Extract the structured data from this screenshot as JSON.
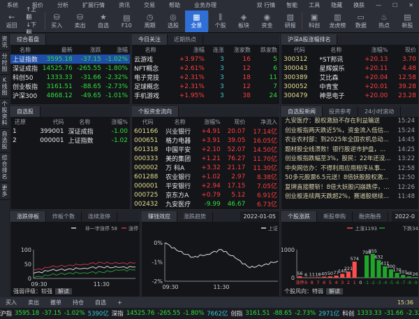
{
  "menu": [
    "系统",
    "报价",
    "分析",
    "扩展行情",
    "资讯",
    "交易",
    "帮助",
    "业务办理"
  ],
  "menu_right": [
    "双 行情",
    "智能",
    "工具",
    "隐藏",
    "换肤"
  ],
  "toolbar": {
    "back": "返回",
    "up": "上翻",
    "down": "下翻",
    "buttons": [
      {
        "label": "买入",
        "icon": "moneybag-icon"
      },
      {
        "label": "卖出",
        "icon": "moneybag-icon"
      },
      {
        "label": "自选",
        "icon": "star-icon"
      },
      {
        "label": "F10",
        "icon": "document-icon"
      },
      {
        "label": "周期",
        "icon": "clock-icon"
      },
      {
        "label": "选股",
        "icon": "chart-icon"
      },
      {
        "label": "全景",
        "icon": "grid-icon",
        "active": true
      },
      {
        "label": "个股",
        "icon": "candles-icon"
      },
      {
        "label": "板块",
        "icon": "layers-icon"
      },
      {
        "label": "资金",
        "icon": "coin-icon"
      },
      {
        "label": "研报",
        "icon": "report-icon"
      },
      {
        "label": "科创",
        "icon": "kc-icon"
      },
      {
        "label": "龙虎榜",
        "icon": "bars-icon"
      },
      {
        "label": "数据",
        "icon": "monitor-icon"
      },
      {
        "label": "热点",
        "icon": "flame-icon"
      },
      {
        "label": "新股",
        "icon": "new-icon"
      }
    ]
  },
  "left_strip": [
    "资讯",
    "分时图",
    "K线图",
    "个股资料",
    "自选股",
    "综合排名",
    "更多"
  ],
  "index_panel": {
    "tab": "综合看盘",
    "headers": [
      "名称",
      "最新",
      "涨跌",
      "涨幅"
    ],
    "rows": [
      [
        "上证指数",
        "3595.18",
        "-37.15",
        "-1.02%"
      ],
      [
        "深证成指",
        "14525.76",
        "-265.55",
        "-1.80%"
      ],
      [
        "科创50",
        "1333.33",
        "-31.66",
        "-2.32%"
      ],
      [
        "创业板指",
        "3161.51",
        "-88.65",
        "-2.73%"
      ],
      [
        "沪深300",
        "4868.12",
        "-49.65",
        "-1.01%"
      ]
    ]
  },
  "hot_panel": {
    "tabs": [
      "今日关注",
      "近期热点"
    ],
    "headers": [
      "名称",
      "涨幅",
      "连涨",
      "涨家数",
      "跌家数"
    ],
    "rows": [
      [
        "云游戏",
        "+3.97%",
        "3",
        "16",
        "5"
      ],
      [
        "NFT概念",
        "+2.61%",
        "3",
        "12",
        "6"
      ],
      [
        "电子竞技",
        "+2.31%",
        "3",
        "18",
        "11"
      ],
      [
        "足球概念",
        "+2.31%",
        "3",
        "12",
        "7"
      ],
      [
        "手机游戏",
        "+1.95%",
        "3",
        "38",
        "24"
      ]
    ]
  },
  "rank_panel": {
    "tab": "沪深A股涨幅排名",
    "headers": [
      "代码",
      "名称",
      "涨幅%",
      "现价"
    ],
    "rows": [
      [
        "300312",
        "*ST邦讯",
        "+20.13",
        "3.70"
      ],
      [
        "300043",
        "星辉娱乐",
        "+20.11",
        "4.48"
      ],
      [
        "300389",
        "艾比森",
        "+20.04",
        "12.58"
      ],
      [
        "300052",
        "中青宝",
        "+20.01",
        "39.28"
      ],
      [
        "300479",
        "神思电子",
        "+20.00",
        "23.28"
      ]
    ]
  },
  "watch_panel": {
    "tab": "自选股",
    "headers": [
      "还原",
      "代码",
      "名称",
      "涨幅%"
    ],
    "rows": [
      [
        "1",
        "399001",
        "深证成指",
        "-1.00"
      ],
      [
        "2",
        "000001",
        "上证指数",
        "-1.02"
      ]
    ]
  },
  "flow_panel": {
    "tab": "个股资金流向",
    "headers": [
      "代码",
      "名称",
      "涨幅%",
      "现价",
      "净流入"
    ],
    "rows": [
      [
        "601166",
        "兴业银行",
        "+4.91",
        "20.07",
        "17.14亿"
      ],
      [
        "000651",
        "格力电器",
        "+3.91",
        "39.05",
        "16.05亿"
      ],
      [
        "601318",
        "中国平安",
        "+2.10",
        "52.07",
        "14.50亿"
      ],
      [
        "000333",
        "美的集团",
        "+1.21",
        "76.27",
        "11.70亿"
      ],
      [
        "000002",
        "万 科A",
        "+3.32",
        "21.17",
        "11.30亿"
      ],
      [
        "601288",
        "农业银行",
        "+1.02",
        "2.97",
        "8.38亿"
      ],
      [
        "000001",
        "平安银行",
        "+2.94",
        "17.15",
        "7.05亿"
      ],
      [
        "000725",
        "京东方A",
        "+0.79",
        "5.12",
        "6.91亿"
      ],
      [
        "002432",
        "九安医疗",
        "-9.99",
        "46.67",
        "6.73亿"
      ]
    ]
  },
  "news_panel": {
    "tabs": [
      "自选股新闻",
      "投资参考",
      "24小时滚动"
    ],
    "items": [
      [
        "九安医疗：股权激励不存在利益输送",
        "15:24"
      ],
      [
        "创业板指两天跌近5%，资金流入低估...",
        "15:24"
      ],
      [
        "农业农村部：到2025年全国农机总动...",
        "14:45"
      ],
      [
        "题材股全线溃败！银行股逆市护盘，...",
        "14:25"
      ],
      [
        "创业板指跌幅至3%，股民：22年还没...",
        "13:22"
      ],
      [
        "中央网信办：不得利用应用程序从事...",
        "12:58"
      ],
      [
        "50多元股票6.5元送！8倍妖股股权激...",
        "12:50"
      ],
      [
        "复牌直接腰斩！8倍大妖股闪崩跌停，...",
        "12:26"
      ],
      [
        "创业板连续两天跌超2%，赛道股继续...",
        "11:48"
      ]
    ]
  },
  "chart_data": [
    {
      "type": "line",
      "tabs": [
        "涨跌停板",
        "炸板个数",
        "连续涨停"
      ],
      "legend": [
        "非一字涨停 58",
        "涨停"
      ],
      "x": [
        "09:30",
        "10:00",
        "10:30",
        "11:00",
        "11:30",
        "13:30",
        "14:00"
      ],
      "xticks": [
        "09:30",
        "11:30"
      ],
      "yticks": [
        "0",
        "50",
        "100"
      ],
      "ylim": [
        0,
        100
      ],
      "series": [
        {
          "name": "非一字涨停 58",
          "color": "#d8d8d8",
          "values": [
            18,
            28,
            32,
            36,
            40,
            38,
            40
          ]
        },
        {
          "name": "涨停",
          "color": "#c0394a",
          "values": [
            28,
            40,
            45,
            50,
            55,
            52,
            54
          ]
        },
        {
          "color": "#2a9a3a",
          "values": [
            3,
            12,
            18,
            20,
            22,
            28,
            30
          ]
        }
      ],
      "footer": "强弱评级：较强",
      "footer_btn": "解读"
    },
    {
      "type": "line",
      "tabs": [
        "赚钱效应",
        "涨跌趋势"
      ],
      "date": "2022-01-05",
      "legend": [
        "上证"
      ],
      "x": [
        "09:30",
        "10:00",
        "10:30",
        "11:00",
        "11:30",
        "13:30",
        "14:00",
        "14:30",
        "15:00"
      ],
      "xticks": [
        "09:30",
        "11:30"
      ],
      "yticks": [
        "0%",
        "-1%",
        "-2%"
      ],
      "ylim": [
        -2,
        0
      ],
      "series": [
        {
          "name": "上证",
          "color": "#e0e0e0",
          "values": [
            0,
            -0.45,
            -0.75,
            -0.6,
            -0.35,
            -0.8,
            -1.3,
            -1.15,
            -0.95
          ]
        }
      ]
    },
    {
      "type": "bar",
      "tabs": [
        "个股涨跌",
        "新股申购",
        "融资融券"
      ],
      "date": "2022-0",
      "legend": [
        "上涨1193",
        "下跌34"
      ],
      "ylim": [
        0,
        1000
      ],
      "yticks": [
        "0",
        "1000"
      ],
      "categories": [
        "涨停",
        "9",
        "8",
        "7",
        "6",
        "5",
        "4",
        "3",
        "2",
        "1",
        "0",
        "-1",
        "-2",
        "-3",
        "-4",
        "-5",
        "-6",
        "-7",
        "-8",
        "-9"
      ],
      "values": [
        56,
        6,
        11,
        18,
        40,
        50,
        77,
        140,
        221,
        574,
        null,
        799,
        855,
        632,
        411,
        300,
        170,
        101,
        48,
        26
      ],
      "up_color": "#ff4d4d",
      "down_color": "#1ea52a",
      "footer": "个股风向：特弱",
      "footer_btn": "解读"
    }
  ],
  "bottombar": [
    "买入",
    "卖出",
    "撤单",
    "持仓",
    "自选",
    "+"
  ],
  "clock": "15:36",
  "ticker": [
    {
      "name": "沪指",
      "price": "3595.18",
      "chg": "-37.15",
      "pct": "-1.02%",
      "amt": "5390亿"
    },
    {
      "name": "深指",
      "price": "14525.76",
      "chg": "-265.55",
      "pct": "-1.80%",
      "amt": "7662亿"
    },
    {
      "name": "创指",
      "price": "3161.51",
      "chg": "-88.65",
      "pct": "-2.73%",
      "amt": "2971亿"
    },
    {
      "name": "科创",
      "price": "1333.33",
      "chg": "-31.66",
      "pct": "-2.32%",
      "amt": "512.5亿"
    }
  ]
}
